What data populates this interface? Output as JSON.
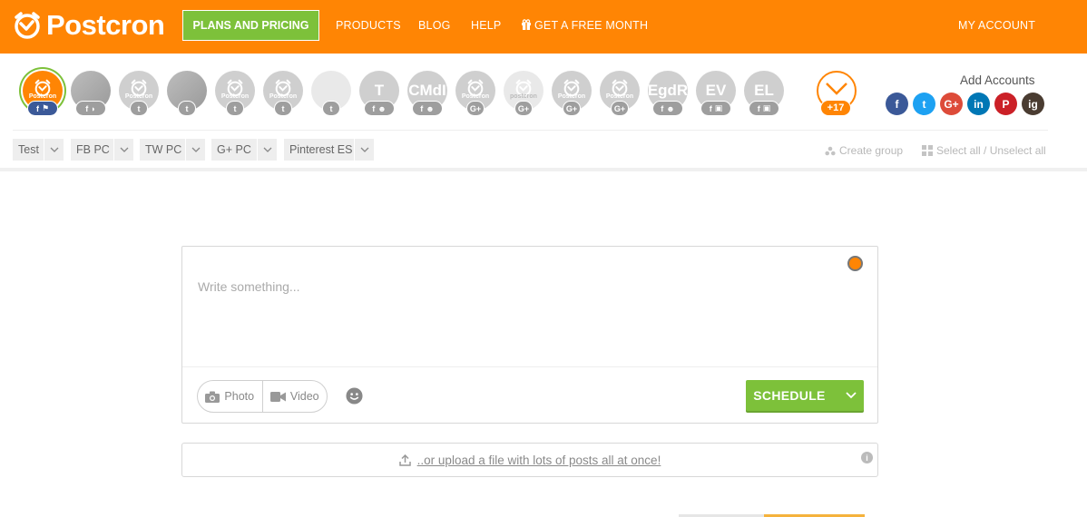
{
  "header": {
    "logo_text": "Postcron",
    "plans_label": "PLANS AND PRICING",
    "nav": [
      "PRODUCTS",
      "BLOG",
      "HELP",
      "GET A FREE MONTH"
    ],
    "account_label": "MY ACCOUNT",
    "brand_color": "#ff8504",
    "accent_color": "#7dc13a"
  },
  "accounts": {
    "avatars": [
      {
        "label": "",
        "sub": "Postcron",
        "badges": [
          "f",
          "flag"
        ],
        "selected": true
      },
      {
        "label": "",
        "sub": "",
        "badges": [
          "f",
          "user"
        ],
        "photo": true
      },
      {
        "label": "",
        "sub": "Postcron",
        "badges": [
          "twitter"
        ]
      },
      {
        "label": "",
        "sub": "",
        "badges": [
          "twitter"
        ],
        "photo": true
      },
      {
        "label": "",
        "sub": "Postcron",
        "badges": [
          "twitter"
        ]
      },
      {
        "label": "",
        "sub": "Postcron",
        "badges": [
          "twitter"
        ]
      },
      {
        "label": "",
        "sub": "",
        "badges": [
          "twitter"
        ],
        "light": true
      },
      {
        "label": "T",
        "sub": "",
        "badges": [
          "f",
          "group"
        ]
      },
      {
        "label": "CMdI",
        "sub": "",
        "badges": [
          "f",
          "group"
        ]
      },
      {
        "label": "",
        "sub": "Postcron",
        "badges": [
          "G+"
        ]
      },
      {
        "label": "",
        "sub": "postcron",
        "badges": [
          "G+"
        ],
        "light": true
      },
      {
        "label": "",
        "sub": "Postcron",
        "badges": [
          "G+"
        ]
      },
      {
        "label": "",
        "sub": "Postcron",
        "badges": [
          "G+"
        ]
      },
      {
        "label": "EgdR",
        "sub": "",
        "badges": [
          "f",
          "group"
        ]
      },
      {
        "label": "EV",
        "sub": "",
        "badges": [
          "f",
          "page"
        ]
      },
      {
        "label": "EL",
        "sub": "",
        "badges": [
          "f",
          "page"
        ]
      }
    ],
    "more_count": "+17",
    "add_accounts_title": "Add Accounts",
    "socials": [
      {
        "name": "facebook",
        "glyph": "f",
        "color": "#3b5998"
      },
      {
        "name": "twitter",
        "glyph": "t",
        "color": "#1da1f2"
      },
      {
        "name": "google-plus",
        "glyph": "G+",
        "color": "#dd4b39"
      },
      {
        "name": "linkedin",
        "glyph": "in",
        "color": "#0077b5"
      },
      {
        "name": "pinterest",
        "glyph": "P",
        "color": "#cb2027"
      },
      {
        "name": "instagram",
        "glyph": "ig",
        "color": "#4a3c31"
      }
    ],
    "groups": [
      "Test",
      "FB PC",
      "TW PC",
      "G+ PC",
      "Pinterest ES"
    ],
    "create_group": "Create group",
    "select_all": "Select all / Unselect all"
  },
  "compose": {
    "placeholder": "Write something...",
    "photo_label": "Photo",
    "video_label": "Video",
    "schedule_label": "SCHEDULE"
  },
  "upload": {
    "link_text": "..or upload a file with lots of posts all at once!"
  }
}
